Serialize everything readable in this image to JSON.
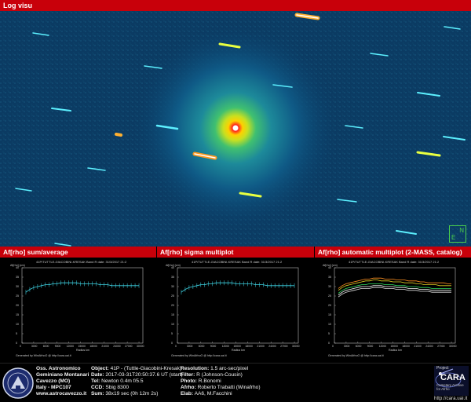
{
  "header": {
    "title": "Log visu"
  },
  "panels": [
    {
      "title": "Af[rho] sum/average"
    },
    {
      "title": "Af[rho] sigma multiplot"
    },
    {
      "title": "Af[rho] automatic multiplot (2-MASS, catalog)"
    }
  ],
  "plot_header": "41P/TUTTLE-GIACOBINI-KRESAK   Band R  date: 31/3/2017 21:2",
  "plot_ylabel": "Af[rho] (cm)",
  "plot_xlabel": "Radius km",
  "plot_generated": "Generated by WinAfrhoO @ http://cara.uai.it",
  "compass": {
    "north": "N",
    "east": "E"
  },
  "observatory": {
    "name": "Oss. Astronomico",
    "name2": "Geminiano Montanari",
    "city": "Cavezzo (MO)",
    "country": "Italy - MPC107",
    "website": "www.astrocavezzo.it"
  },
  "obs_info": {
    "object": "41P - (Tuttle-Giacobini-Kresak)",
    "date": "2017-03-31T20:50:37.6 UT (start)",
    "tel": "Newton 0.4m f/5.5",
    "ccd": "Sbig 8300",
    "sum": "38x19 sec (0h 12m 2s)"
  },
  "obs_info2": {
    "resolution": "1.5 arc-sec/pixel",
    "filter": "R (Johnson-Cousin)",
    "photo": "R.Bonomi",
    "afrho": "Roberto Trabatti (Winafrho)",
    "elab": "AA6, M.Facchini"
  },
  "labels": {
    "object": "Object:",
    "date": "Date:",
    "tel": "Tel:",
    "ccd": "CCD:",
    "sum": "Sum:",
    "resolution": "Resolution:",
    "filter": "Filter:",
    "photo": "Photo:",
    "afrho": "Afrho:",
    "elab": "Elab:"
  },
  "cara": {
    "project": "Project",
    "name": "CARA",
    "sub": "Cometary Archive for Afrho",
    "url": "http://cara.uai.it"
  },
  "chart_data": [
    {
      "type": "line",
      "title": "Af[rho] sum/average",
      "x": [
        1000,
        2000,
        3000,
        4000,
        5000,
        6000,
        7000,
        8000,
        9000,
        10000,
        11000,
        12000,
        13000,
        14000,
        15000,
        16000,
        17000,
        18000,
        19000,
        20000,
        21000,
        22000,
        23000,
        24000,
        25000,
        26000,
        27000,
        28000,
        29000,
        30000
      ],
      "series": [
        {
          "values": [
            27,
            28.5,
            29.5,
            30,
            30.5,
            31,
            31,
            31.5,
            31.5,
            32,
            32,
            32,
            32,
            32,
            31.5,
            31.5,
            31.5,
            31.5,
            31.5,
            31,
            31,
            31,
            30.5,
            30.5,
            30.5,
            30.5,
            30.5,
            30.5,
            30.5,
            30.5
          ]
        }
      ],
      "ylim": [
        0,
        40
      ]
    },
    {
      "type": "line",
      "title": "Af[rho] sigma multiplot",
      "x": [
        1000,
        2000,
        3000,
        4000,
        5000,
        6000,
        7000,
        8000,
        9000,
        10000,
        11000,
        12000,
        13000,
        14000,
        15000,
        16000,
        17000,
        18000,
        19000,
        20000,
        21000,
        22000,
        23000,
        24000,
        25000,
        26000,
        27000,
        28000,
        29000,
        30000
      ],
      "series": [
        {
          "values": [
            27,
            28.5,
            29.5,
            30,
            30.5,
            31,
            31,
            31.5,
            31.5,
            32,
            32,
            32,
            32,
            32,
            31.5,
            31.5,
            31.5,
            31.5,
            31.5,
            31,
            31,
            31,
            30.5,
            30.5,
            30.5,
            30.5,
            30.5,
            30.5,
            30.5,
            30.5
          ]
        }
      ],
      "ylim": [
        0,
        40
      ]
    },
    {
      "type": "line",
      "title": "Af[rho] automatic multiplot (2-MASS, catalog)",
      "x": [
        1000,
        2000,
        3000,
        4000,
        5000,
        6000,
        7000,
        8000,
        9000,
        10000,
        11000,
        12000,
        13000,
        14000,
        15000,
        16000,
        17000,
        18000,
        19000,
        20000,
        21000,
        22000,
        23000,
        24000,
        25000,
        26000,
        27000,
        28000,
        29000,
        30000
      ],
      "series": [
        {
          "values": [
            29,
            30.5,
            31.5,
            32,
            32.5,
            33,
            33.5,
            34,
            34,
            34.5,
            34.5,
            34.5,
            34,
            34,
            34,
            33.5,
            33.5,
            33.5,
            33,
            33,
            33,
            32.5,
            32.5,
            32,
            32,
            32,
            32,
            32,
            31.5,
            31.5
          ]
        },
        {
          "values": [
            28,
            29.5,
            30.5,
            31,
            31.5,
            32,
            32.5,
            33,
            33,
            33.5,
            33.5,
            33,
            33,
            33,
            32.5,
            32.5,
            32.5,
            32,
            32,
            32,
            31.5,
            31.5,
            31,
            31,
            31,
            31,
            30.5,
            30.5,
            30.5,
            30.5
          ]
        },
        {
          "values": [
            26.5,
            28,
            29,
            29.5,
            30,
            30.5,
            31,
            31,
            31.5,
            31.5,
            31.5,
            31.5,
            31,
            31,
            31,
            30.5,
            30.5,
            30.5,
            30,
            30,
            30,
            29.5,
            29.5,
            29.5,
            29,
            29,
            29,
            29,
            29,
            29
          ]
        },
        {
          "values": [
            25.5,
            27,
            28,
            28.5,
            29,
            29.5,
            30,
            30,
            30,
            30.5,
            30.5,
            30.5,
            30,
            30,
            30,
            29.5,
            29.5,
            29.5,
            29,
            29,
            29,
            28.5,
            28.5,
            28.5,
            28,
            28,
            28,
            28,
            28,
            28
          ]
        },
        {
          "values": [
            24.5,
            26,
            27,
            27.5,
            28,
            28.5,
            29,
            29,
            29,
            29.5,
            29.5,
            29.5,
            29,
            29,
            29,
            28.5,
            28.5,
            28.5,
            28,
            28,
            28,
            27.5,
            27.5,
            27.5,
            27,
            27,
            27,
            27,
            27,
            27
          ]
        }
      ],
      "ylim": [
        0,
        40
      ]
    }
  ]
}
